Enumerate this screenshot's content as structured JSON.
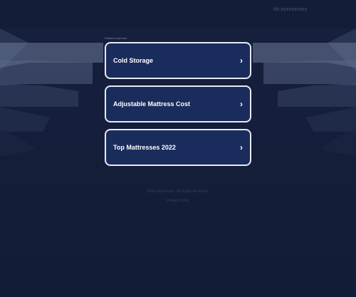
{
  "header": {
    "domain": "hh.xxxxxxxxxx"
  },
  "main": {
    "related_label": "Related searches",
    "links": [
      {
        "label": "Cold Storage",
        "arrow": "›"
      },
      {
        "label": "Adjustable Mattress Cost",
        "arrow": "›"
      },
      {
        "label": "Top Mattresses 2022",
        "arrow": "›"
      }
    ]
  },
  "footer": {
    "copyright": "2022 xxxxxxxxxx . All Rights Reserved.",
    "privacy": "Privacy Policy"
  },
  "colors": {
    "background": "#151f3b",
    "card_fill": "#1a2c5c",
    "card_border": "#e6ebf5"
  }
}
